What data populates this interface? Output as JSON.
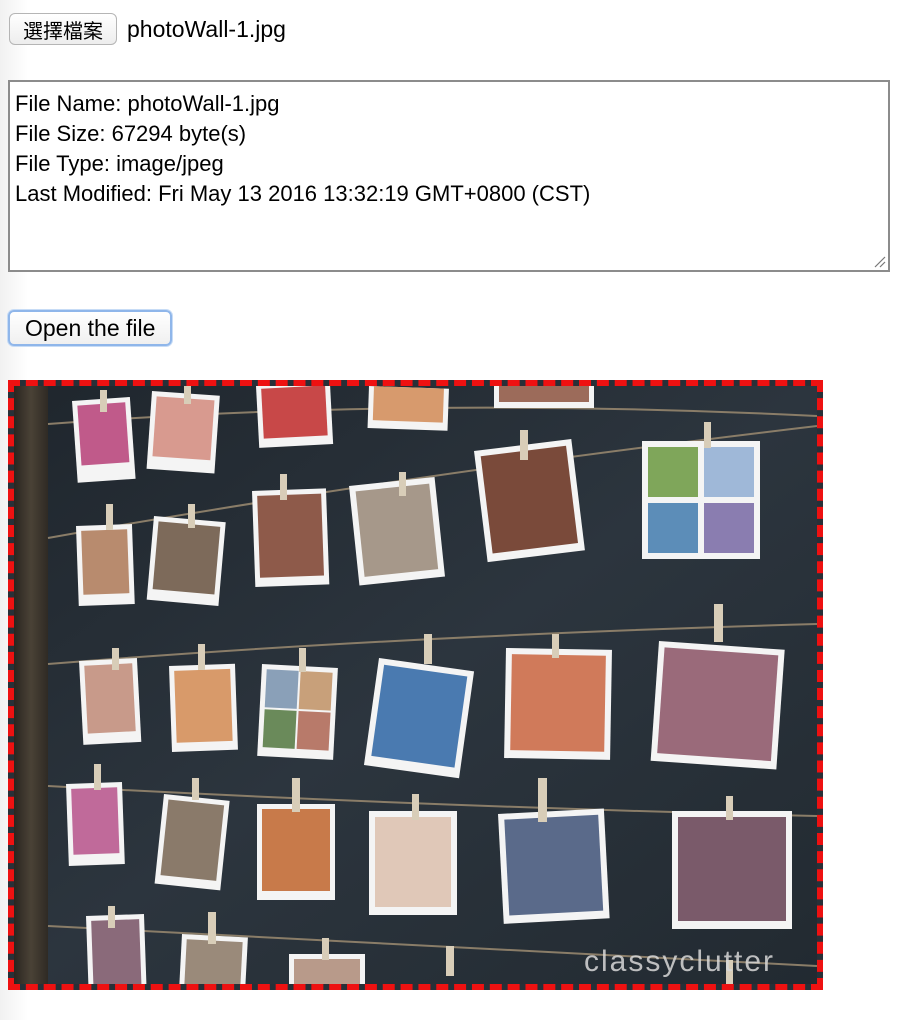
{
  "file_input": {
    "button_label": "選擇檔案",
    "selected_file": "photoWall-1.jpg"
  },
  "file_info": {
    "lines": [
      "File Name: photoWall-1.jpg",
      "File Size: 67294 byte(s)",
      "File Type: image/jpeg",
      "Last Modified: Fri May 13 2016 13:32:19 GMT+0800 (CST)"
    ]
  },
  "open_button": {
    "label": "Open the file"
  },
  "preview": {
    "watermark": "classyclutter",
    "border_color": "#ee1111",
    "wall_color": "#273038"
  }
}
